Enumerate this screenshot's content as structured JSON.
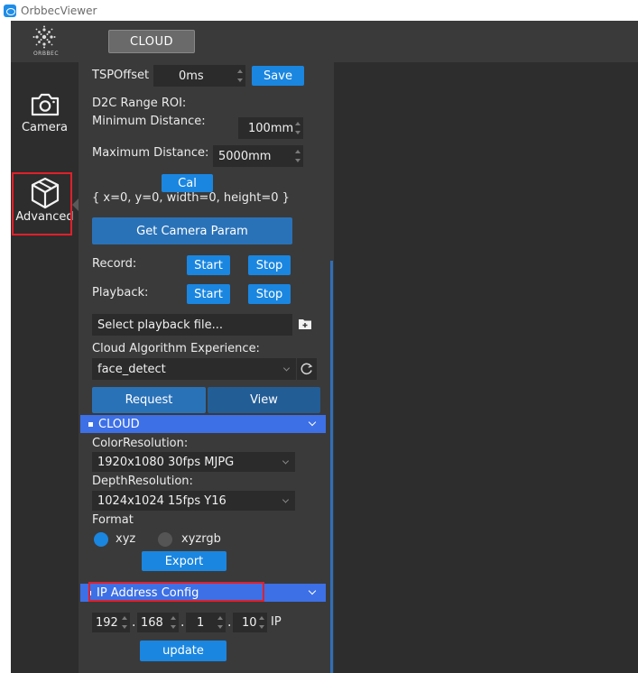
{
  "window": {
    "title": "OrbbecViewer"
  },
  "topbar": {
    "logo_text": "ORBBEC",
    "mode_button": "CLOUD"
  },
  "sidebar": {
    "items": [
      {
        "label": "Camera",
        "icon": "camera-icon"
      },
      {
        "label": "Advanced",
        "icon": "cube-icon"
      }
    ]
  },
  "panel": {
    "tsp": {
      "label": "TSPOffset",
      "value": "0ms",
      "save": "Save"
    },
    "d2c": {
      "title": "D2C Range ROI:",
      "min_label": "Minimum Distance:",
      "min_value": "100mm",
      "max_label": "Maximum Distance:",
      "max_value": "5000mm",
      "cal": "Cal",
      "roi": "{ x=0, y=0, width=0, height=0 }"
    },
    "get_param": "Get Camera Param",
    "record": {
      "label": "Record:",
      "start": "Start",
      "stop": "Stop"
    },
    "playback": {
      "label": "Playback:",
      "start": "Start",
      "stop": "Stop",
      "file_placeholder": "Select playback file..."
    },
    "cloud_algo": {
      "label": "Cloud Algorithm Experience:",
      "selected": "face_detect",
      "request": "Request",
      "view": "View"
    },
    "cloud_section": {
      "title": "CLOUD",
      "color_res_label": "ColorResolution:",
      "color_res_value": "1920x1080 30fps MJPG",
      "depth_res_label": "DepthResolution:",
      "depth_res_value": "1024x1024 15fps Y16",
      "format_label": "Format",
      "format_options": [
        "xyz",
        "xyzrgb"
      ],
      "format_selected": "xyz",
      "export": "Export"
    },
    "ip_section": {
      "title": "IP Address Config",
      "octets": [
        "192",
        "168",
        "1",
        "10"
      ],
      "ip_label": "IP",
      "update": "update"
    }
  },
  "colors": {
    "accent": "#1a86e0",
    "section": "#3d70e6",
    "highlight": "#e0202a"
  }
}
